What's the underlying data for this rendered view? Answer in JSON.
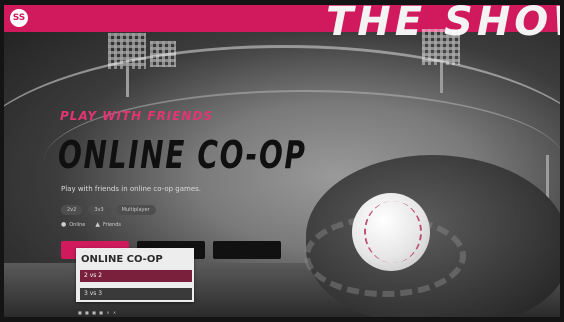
{
  "header": {
    "brand_badge": "SS",
    "show_title": "THE SHOW"
  },
  "hero": {
    "eyebrow": "PLAY WITH FRIENDS",
    "headline": "ONLINE CO-OP",
    "subtitle": "Play with friends in online co-op games.",
    "tags": [
      "2v2",
      "3v3",
      "Multiplayer"
    ],
    "meta": [
      {
        "icon": "users-icon",
        "label": "Online"
      },
      {
        "icon": "warning-icon",
        "label": "Friends"
      }
    ],
    "buttons": [
      {
        "label": "",
        "style": "primary"
      },
      {
        "label": "",
        "style": "dark"
      },
      {
        "label": "",
        "style": "dark-pink"
      }
    ]
  },
  "dropdown": {
    "title": "ONLINE CO-OP",
    "options": [
      "2 vs 2",
      "3 vs 3"
    ],
    "selected_index": 0
  },
  "footer": {
    "hint": "■ ■ ■ ■ ✕ ✕"
  },
  "colors": {
    "brand_pink": "#d11a5e",
    "selected_option": "#7a1f3c"
  }
}
